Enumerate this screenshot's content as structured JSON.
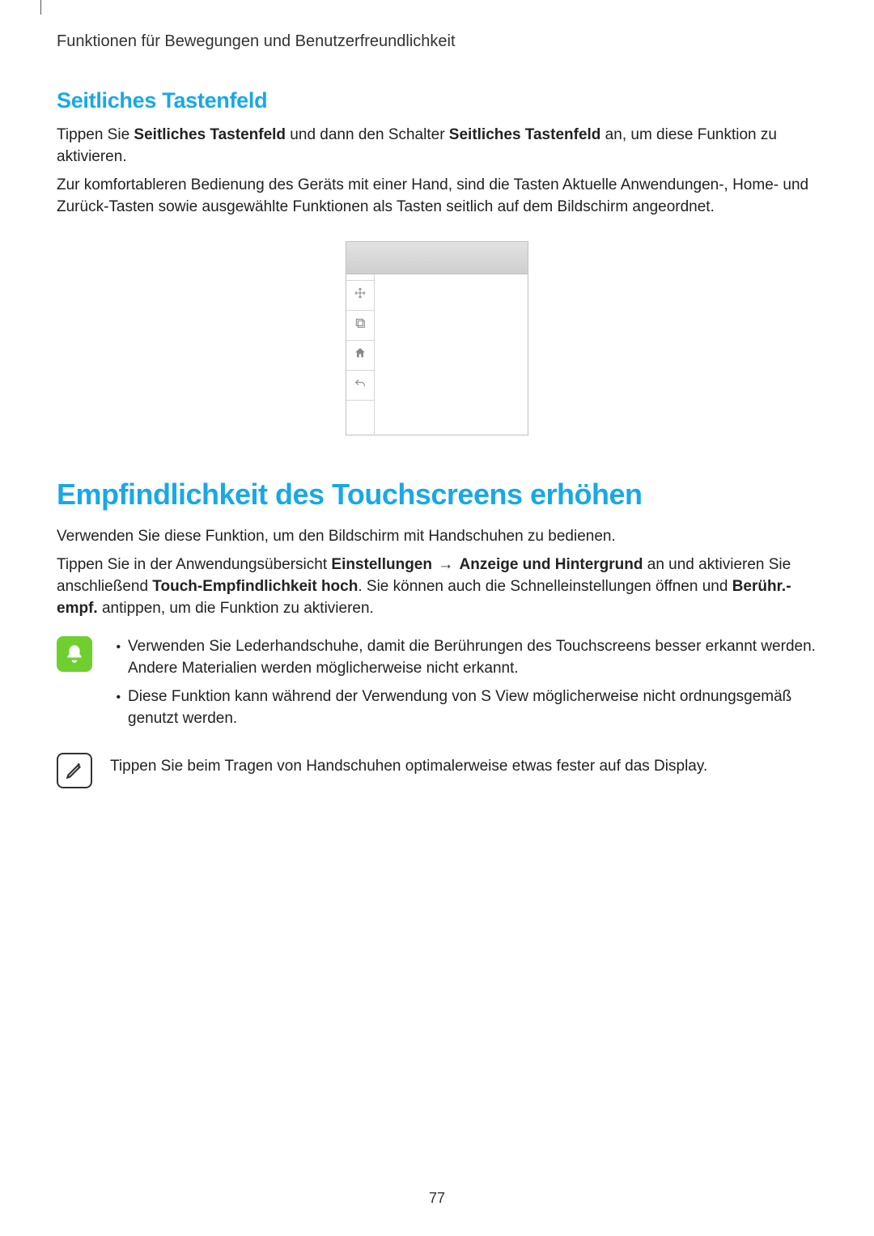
{
  "header": "Funktionen für Bewegungen und Benutzerfreundlichkeit",
  "section1": {
    "title": "Seitliches Tastenfeld",
    "p1_pre": "Tippen Sie ",
    "p1_b1": "Seitliches Tastenfeld",
    "p1_mid": " und dann den Schalter ",
    "p1_b2": "Seitliches Tastenfeld",
    "p1_post": " an, um diese Funktion zu aktivieren.",
    "p2": "Zur komfortableren Bedienung des Geräts mit einer Hand, sind die Tasten Aktuelle Anwendungen-, Home- und Zurück-Tasten sowie ausgewählte Funktionen als Tasten seitlich auf dem Bildschirm angeordnet."
  },
  "section2": {
    "title": "Empfindlichkeit des Touchscreens erhöhen",
    "p1": "Verwenden Sie diese Funktion, um den Bildschirm mit Handschuhen zu bedienen.",
    "p2_pre": "Tippen Sie in der Anwendungsübersicht ",
    "p2_b1": "Einstellungen",
    "p2_arrow": " → ",
    "p2_b2": "Anzeige und Hintergrund",
    "p2_mid": " an und aktivieren Sie anschließend ",
    "p2_b3": "Touch-Empfindlichkeit hoch",
    "p2_mid2": ". Sie können auch die Schnelleinstellungen öffnen und ",
    "p2_b4": "Berühr.-empf.",
    "p2_post": " antippen, um die Funktion zu aktivieren."
  },
  "notes": {
    "bell": {
      "items": [
        "Verwenden Sie Lederhandschuhe, damit die Berührungen des Touchscreens besser erkannt werden. Andere Materialien werden möglicherweise nicht erkannt.",
        "Diese Funktion kann während der Verwendung von S View möglicherweise nicht ordnungsgemäß genutzt werden."
      ]
    },
    "pen": {
      "text": "Tippen Sie beim Tragen von Handschuhen optimalerweise etwas fester auf das Display."
    }
  },
  "page_number": "77"
}
